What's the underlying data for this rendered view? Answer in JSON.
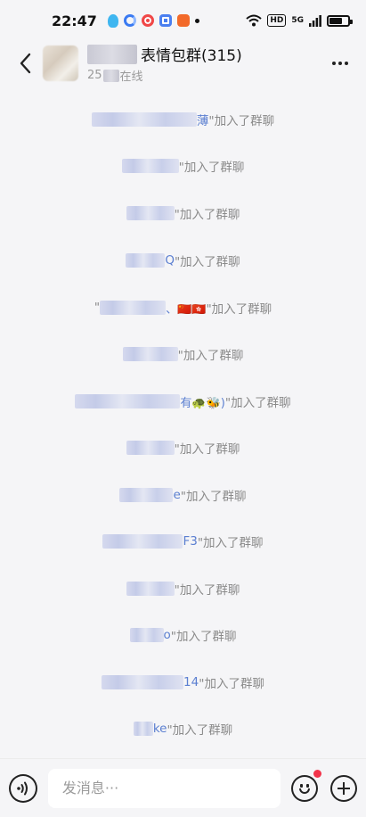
{
  "status_bar": {
    "time": "22:47",
    "network": "5G",
    "hd_label": "HD"
  },
  "header": {
    "group_name_visible": "表情包群(315)",
    "online_text_visible": "25",
    "online_suffix": "在线"
  },
  "messages": [
    {
      "name_tail": "薄",
      "suffix": "\"加入了群聊"
    },
    {
      "name_tail": "",
      "suffix": "\"加入了群聊"
    },
    {
      "name_tail": "",
      "suffix": "\"加入了群聊"
    },
    {
      "name_tail": "Q",
      "suffix": "\"加入了群聊"
    },
    {
      "name_tail": "、🇨🇳🇭🇰",
      "suffix": "\"加入了群聊"
    },
    {
      "name_tail": "",
      "suffix": "\"加入了群聊"
    },
    {
      "name_tail": "有🐢🐝)",
      "suffix": "\"加入了群聊"
    },
    {
      "name_tail": "",
      "suffix": "\"加入了群聊"
    },
    {
      "name_tail": "e",
      "suffix": "\"加入了群聊"
    },
    {
      "name_tail": "F3",
      "suffix": "\"加入了群聊"
    },
    {
      "name_tail": "",
      "suffix": "\"加入了群聊"
    },
    {
      "name_tail": "o",
      "suffix": "\"加入了群聊"
    },
    {
      "name_tail": "14",
      "suffix": "\"加入了群聊"
    },
    {
      "name_tail": "ke",
      "suffix": "\"加入了群聊"
    }
  ],
  "input": {
    "placeholder": "发消息···"
  },
  "colors": {
    "background": "#f5f5f7",
    "system_text": "#8a8a8a",
    "name_link": "#5b7fd1",
    "badge_red": "#f2344a"
  }
}
